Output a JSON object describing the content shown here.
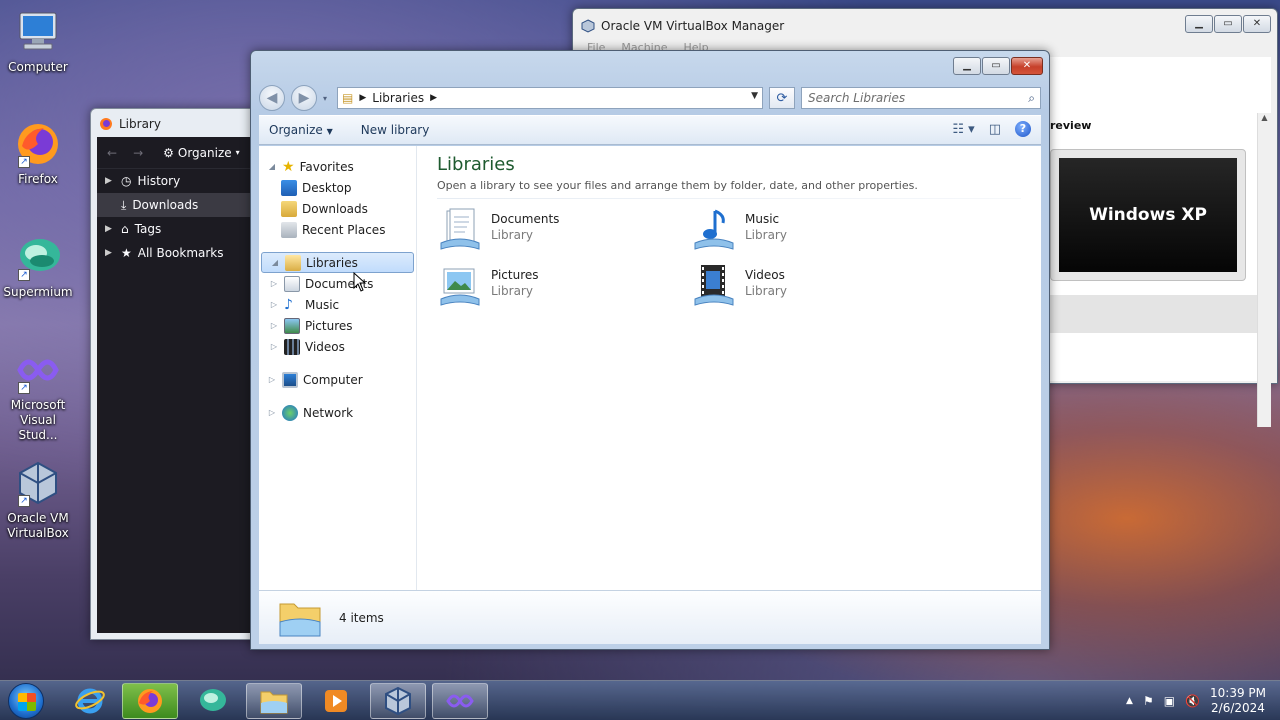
{
  "desktop": {
    "icons": [
      {
        "label": "Computer"
      },
      {
        "label": "Firefox"
      },
      {
        "label": "Supermium"
      },
      {
        "label": "Microsoft Visual Stud..."
      },
      {
        "label": "Oracle VM VirtualBox"
      }
    ]
  },
  "vbox": {
    "title": "Oracle VM VirtualBox Manager",
    "menu": [
      "File",
      "Machine",
      "Help"
    ],
    "preview_label": "review",
    "preview_screen_text": "Windows XP"
  },
  "firefox_library": {
    "title": "Library",
    "organize_label": "Organize",
    "items": [
      {
        "label": "History"
      },
      {
        "label": "Downloads"
      },
      {
        "label": "Tags"
      },
      {
        "label": "All Bookmarks"
      }
    ]
  },
  "explorer": {
    "breadcrumb": "Libraries",
    "search_placeholder": "Search Libraries",
    "commands": {
      "organize": "Organize",
      "new_library": "New library"
    },
    "nav": {
      "favorites": "Favorites",
      "favorites_items": [
        "Desktop",
        "Downloads",
        "Recent Places"
      ],
      "libraries": "Libraries",
      "libraries_items": [
        "Documents",
        "Music",
        "Pictures",
        "Videos"
      ],
      "computer": "Computer",
      "network": "Network"
    },
    "main": {
      "heading": "Libraries",
      "subtitle": "Open a library to see your files and arrange them by folder, date, and other properties.",
      "tiles": [
        {
          "name": "Documents",
          "type": "Library"
        },
        {
          "name": "Music",
          "type": "Library"
        },
        {
          "name": "Pictures",
          "type": "Library"
        },
        {
          "name": "Videos",
          "type": "Library"
        }
      ]
    },
    "details": {
      "count": "4 items"
    }
  },
  "taskbar": {
    "time": "10:39 PM",
    "date": "2/6/2024"
  },
  "colors": {
    "accent_green": "#1e5a2f",
    "selection_blue": "#c1dcfc",
    "close_red": "#c6402a"
  }
}
